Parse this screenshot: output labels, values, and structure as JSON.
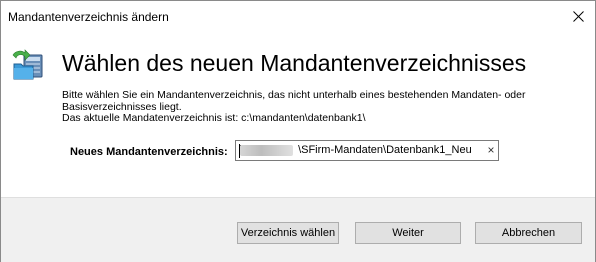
{
  "window": {
    "title": "Mandantenverzeichnis ändern",
    "close_glyph": "✕"
  },
  "main": {
    "heading": "Wählen des neuen Mandantenverzeichnisses",
    "description": [
      "Bitte wählen Sie ein Mandantenverzeichnis, das nicht unterhalb eines bestehenden Mandaten- oder",
      "Basisverzeichnisses liegt.",
      "Das aktuelle Mandatenverzeichnis ist: c:\\mandanten\\datenbank1\\"
    ],
    "field_label": "Neues Mandantenverzeichnis:",
    "field_value_prefix": "\\",
    "field_value_hidden": "xxxxxxxxxx",
    "field_value_suffix": "\\SFirm-Mandaten\\Datenbank1_Neu",
    "clear_glyph": "×",
    "icon": "folder-network-icon"
  },
  "footer": {
    "buttons": [
      {
        "label": "Verzeichnis wählen"
      },
      {
        "label": "Weiter"
      },
      {
        "label": "Abbrechen"
      }
    ]
  },
  "colors": {
    "footer_bg": "#f0f0f0",
    "button_bg": "#e1e1e1",
    "button_border": "#adadad"
  }
}
